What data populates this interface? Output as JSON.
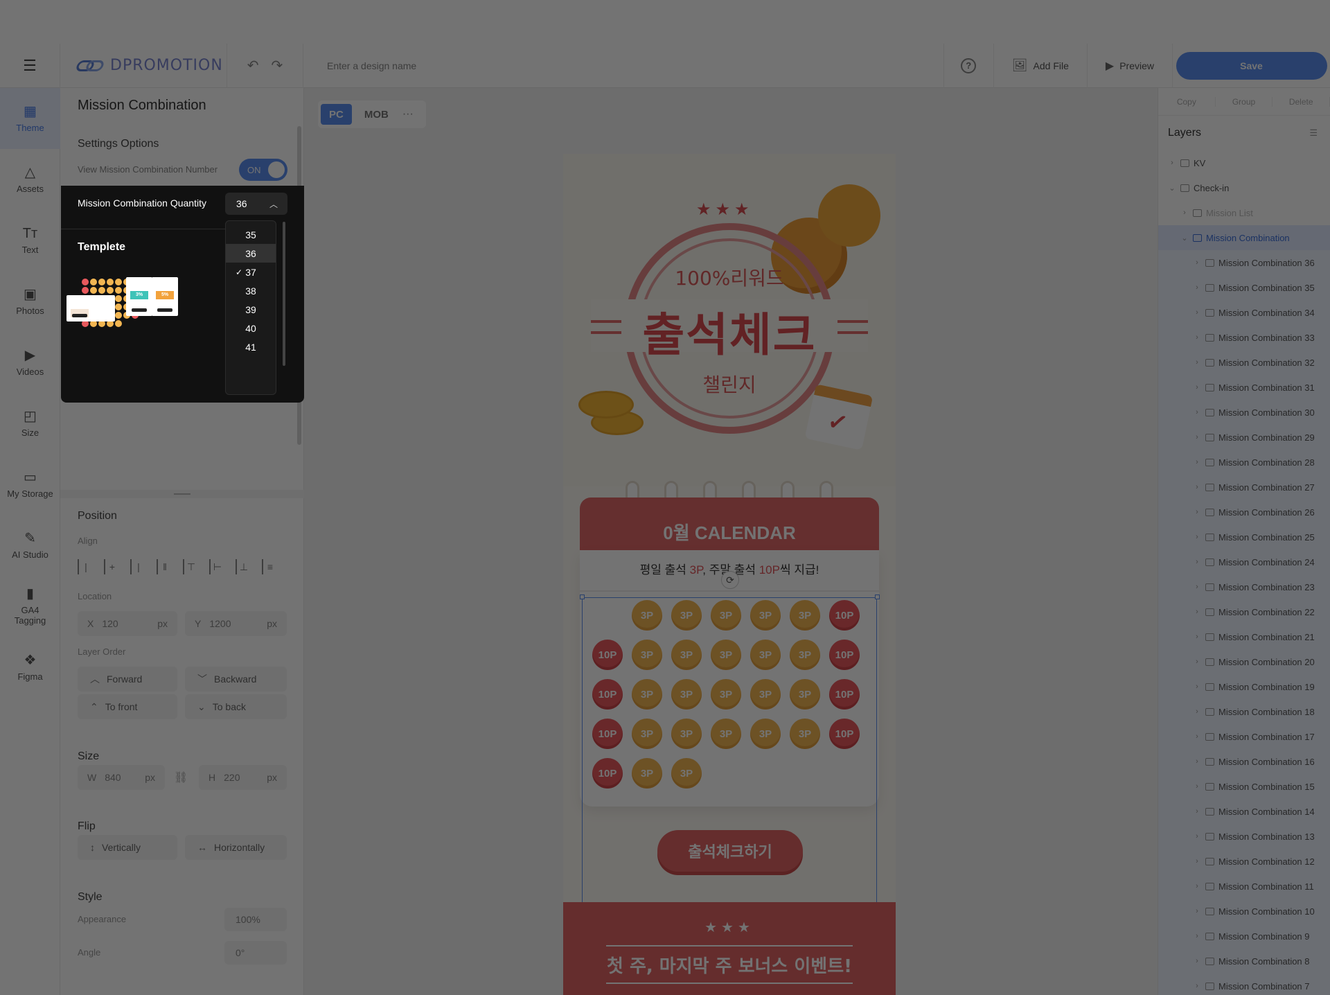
{
  "app": {
    "logo": "DPROMOTION",
    "design_name_placeholder": "Enter a design name"
  },
  "header": {
    "add_file": "Add File",
    "preview": "Preview",
    "save": "Save",
    "help": "?"
  },
  "rail": [
    {
      "label": "Theme",
      "icon": "theme-icon"
    },
    {
      "label": "Assets",
      "icon": "assets-icon"
    },
    {
      "label": "Text",
      "icon": "text-icon"
    },
    {
      "label": "Photos",
      "icon": "photos-icon"
    },
    {
      "label": "Videos",
      "icon": "videos-icon"
    },
    {
      "label": "Size",
      "icon": "size-icon"
    },
    {
      "label": "My Storage",
      "icon": "storage-icon"
    },
    {
      "label": "AI Studio",
      "icon": "ai-studio-icon"
    },
    {
      "label": "GA4 Tagging",
      "icon": "ga4-icon"
    },
    {
      "label": "Figma",
      "icon": "figma-icon"
    }
  ],
  "panel": {
    "title": "Mission Combination",
    "settings_label": "Settings Options",
    "view_number_label": "View Mission Combination Number",
    "toggle": "ON",
    "quantity_label": "Mission Combination Quantity",
    "quantity_value": "36",
    "quantity_options": [
      "35",
      "36",
      "37",
      "38",
      "39",
      "40",
      "41"
    ],
    "checked_option": "37",
    "template_label": "Templete",
    "template_card_labels": [
      "3%",
      "5%"
    ],
    "position": "Position",
    "align": "Align",
    "location": "Location",
    "x_label": "X",
    "x_value": "120",
    "y_label": "Y",
    "y_value": "1200",
    "unit": "px",
    "layer_order": "Layer Order",
    "forward": "Forward",
    "backward": "Backward",
    "to_front": "To front",
    "to_back": "To back",
    "size": "Size",
    "w_label": "W",
    "w_value": "840",
    "h_label": "H",
    "h_value": "220",
    "flip": "Flip",
    "vertically": "Vertically",
    "horizontally": "Horizontally",
    "style": "Style",
    "appearance": "Appearance",
    "appearance_value": "100%",
    "angle": "Angle",
    "angle_value": "0°"
  },
  "canvas": {
    "tabs": [
      "PC",
      "MOB"
    ],
    "active_tab": "PC",
    "more": "···"
  },
  "artboard": {
    "stars": "★★★",
    "reward": "100%리워드",
    "title": "출석체크",
    "challenge": "챌린지",
    "calendar_title": "0월 CALENDAR",
    "calendar_sub_pre": "평일 출석 ",
    "calendar_sub_p1": "3P",
    "calendar_sub_mid": ", 주말 출석 ",
    "calendar_sub_p2": "10P",
    "calendar_sub_post": "씩 지급!",
    "cells": [
      "",
      "3P",
      "3P",
      "3P",
      "3P",
      "3P",
      "10P",
      "10P",
      "3P",
      "3P",
      "3P",
      "3P",
      "3P",
      "10P",
      "10P",
      "3P",
      "3P",
      "3P",
      "3P",
      "3P",
      "10P",
      "10P",
      "3P",
      "3P",
      "3P",
      "3P",
      "3P",
      "10P",
      "10P",
      "3P",
      "3P"
    ],
    "cta": "출석체크하기",
    "footer_stars": "★★★",
    "footer_text": "첫 주, 마지막 주 보너스 이벤트!"
  },
  "right": {
    "actions": [
      "Copy",
      "Group",
      "Delete"
    ],
    "layers_title": "Layers",
    "layers": [
      {
        "name": "KV",
        "level": 0,
        "state": "normal"
      },
      {
        "name": "Check-in",
        "level": 0,
        "state": "open"
      },
      {
        "name": "Mission List",
        "level": 1,
        "state": "dim"
      },
      {
        "name": "Mission Combination",
        "level": 1,
        "state": "selected"
      },
      {
        "name": "Mission Combination 36",
        "level": 2,
        "state": "child"
      },
      {
        "name": "Mission Combination 35",
        "level": 2,
        "state": "child"
      },
      {
        "name": "Mission Combination 34",
        "level": 2,
        "state": "child"
      },
      {
        "name": "Mission Combination 33",
        "level": 2,
        "state": "child"
      },
      {
        "name": "Mission Combination 32",
        "level": 2,
        "state": "child"
      },
      {
        "name": "Mission Combination 31",
        "level": 2,
        "state": "child"
      },
      {
        "name": "Mission Combination 30",
        "level": 2,
        "state": "child"
      },
      {
        "name": "Mission Combination 29",
        "level": 2,
        "state": "child"
      },
      {
        "name": "Mission Combination 28",
        "level": 2,
        "state": "child"
      },
      {
        "name": "Mission Combination 27",
        "level": 2,
        "state": "child"
      },
      {
        "name": "Mission Combination 26",
        "level": 2,
        "state": "child"
      },
      {
        "name": "Mission Combination 25",
        "level": 2,
        "state": "child"
      },
      {
        "name": "Mission Combination 24",
        "level": 2,
        "state": "child"
      },
      {
        "name": "Mission Combination 23",
        "level": 2,
        "state": "child"
      },
      {
        "name": "Mission Combination 22",
        "level": 2,
        "state": "child"
      },
      {
        "name": "Mission Combination 21",
        "level": 2,
        "state": "child"
      },
      {
        "name": "Mission Combination 20",
        "level": 2,
        "state": "child"
      },
      {
        "name": "Mission Combination 19",
        "level": 2,
        "state": "child"
      },
      {
        "name": "Mission Combination 18",
        "level": 2,
        "state": "child"
      },
      {
        "name": "Mission Combination 17",
        "level": 2,
        "state": "child"
      },
      {
        "name": "Mission Combination 16",
        "level": 2,
        "state": "child"
      },
      {
        "name": "Mission Combination 15",
        "level": 2,
        "state": "child"
      },
      {
        "name": "Mission Combination 14",
        "level": 2,
        "state": "child"
      },
      {
        "name": "Mission Combination 13",
        "level": 2,
        "state": "child"
      },
      {
        "name": "Mission Combination 12",
        "level": 2,
        "state": "child"
      },
      {
        "name": "Mission Combination 11",
        "level": 2,
        "state": "child"
      },
      {
        "name": "Mission Combination 10",
        "level": 2,
        "state": "child"
      },
      {
        "name": "Mission Combination 9",
        "level": 2,
        "state": "child"
      },
      {
        "name": "Mission Combination 8",
        "level": 2,
        "state": "child"
      },
      {
        "name": "Mission Combination 7",
        "level": 2,
        "state": "child"
      }
    ]
  },
  "colors": {
    "accent": "#5b8ff0",
    "coral": "#e06868",
    "coin": "#f2b652",
    "overlay": "rgba(0,0,0,0.55)"
  }
}
